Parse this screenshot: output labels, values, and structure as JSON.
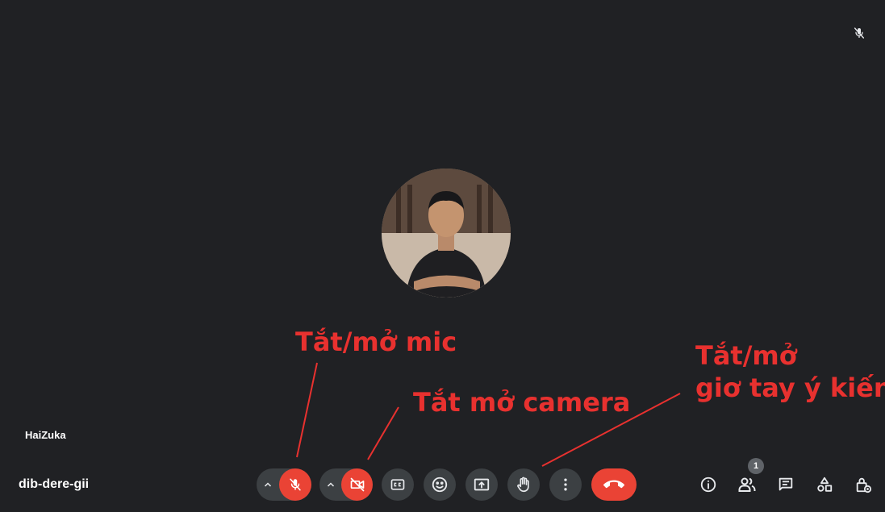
{
  "participant": {
    "name": "HaiZuka"
  },
  "meeting": {
    "code": "dib-dere-gii"
  },
  "people": {
    "count": "1"
  },
  "annotations": {
    "mic": "Tắt/mở mic",
    "camera": "Tắt mở camera",
    "hand_line1": "Tắt/mở",
    "hand_line2": "giơ tay ý kiến"
  },
  "colors": {
    "background": "#202124",
    "button": "#3c4043",
    "danger": "#ea4335",
    "annotation": "#e8312f"
  },
  "icons": {
    "tile": "mic-off-icon",
    "controls": [
      "chevron-up-icon",
      "mic-off-icon",
      "chevron-up-icon",
      "camera-off-icon",
      "captions-icon",
      "emoji-icon",
      "present-screen-icon",
      "raise-hand-icon",
      "more-vert-icon",
      "call-end-icon"
    ],
    "side": [
      "info-icon",
      "people-icon",
      "chat-icon",
      "activities-icon",
      "host-controls-icon"
    ]
  }
}
